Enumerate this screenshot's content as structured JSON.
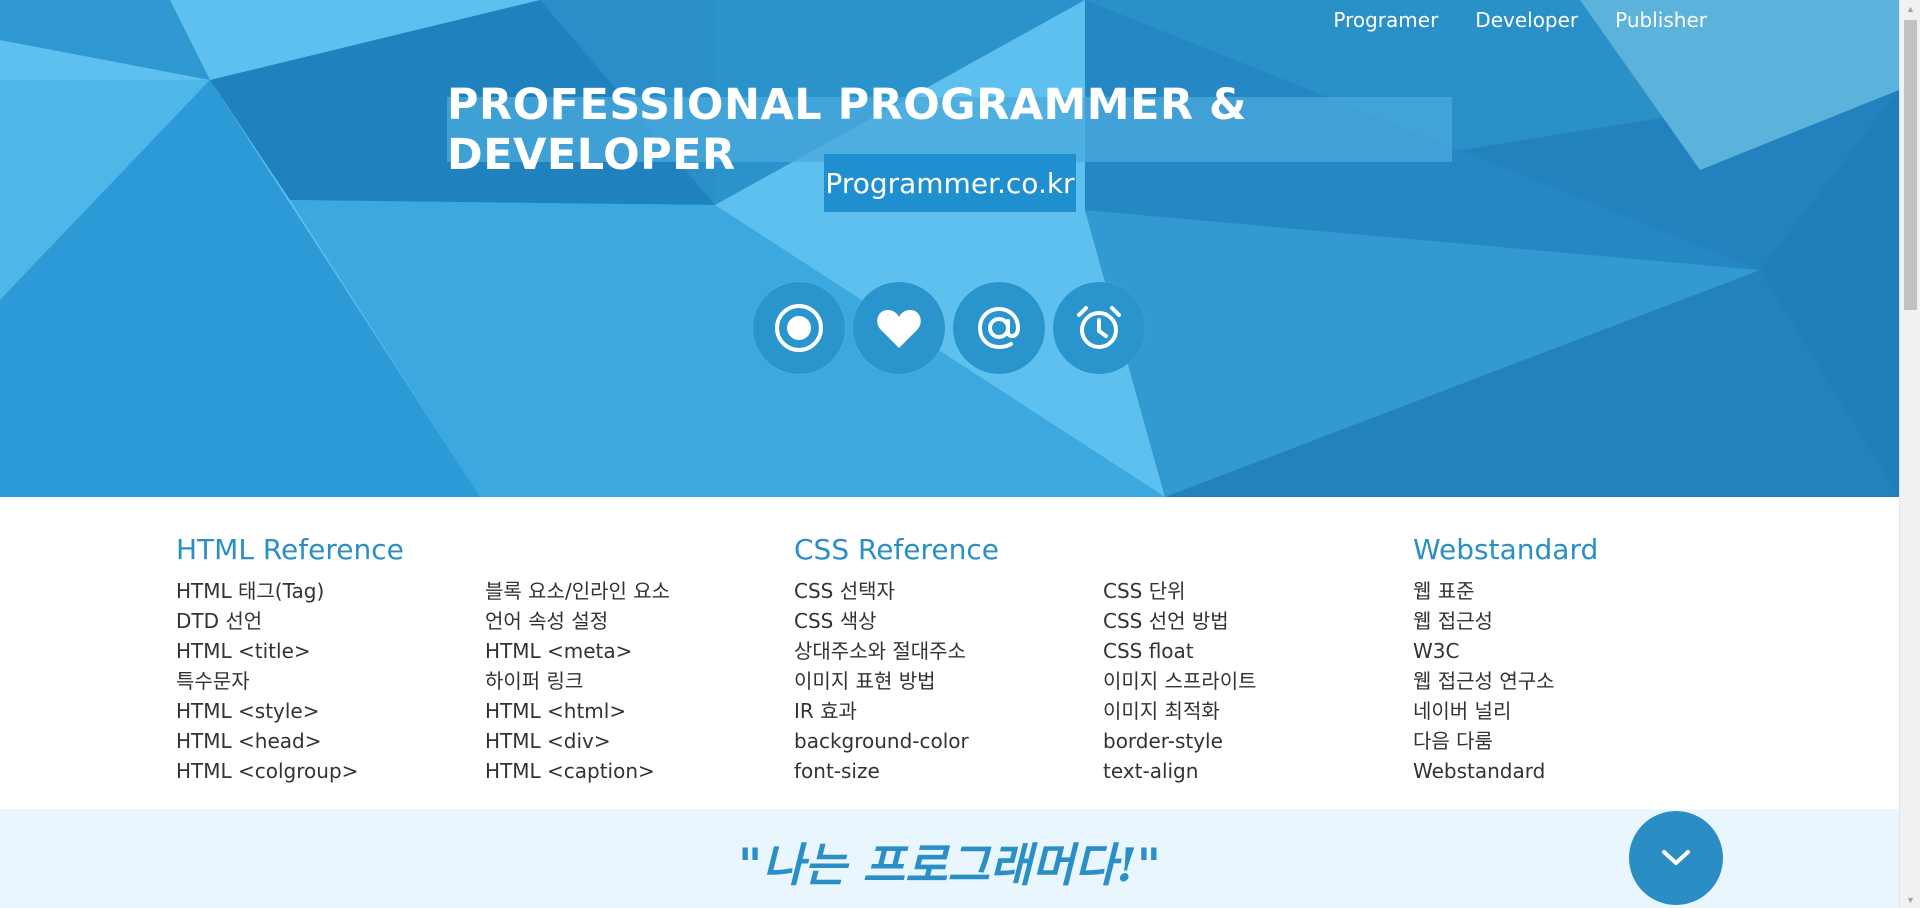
{
  "nav": {
    "items": [
      "Programer",
      "Developer",
      "Publisher"
    ]
  },
  "hero": {
    "title": "PROFESSIONAL PROGRAMMER & DEVELOPER",
    "subtitle": "Programmer.co.kr",
    "icons": [
      "target-icon",
      "heart-icon",
      "at-sign-icon",
      "alarm-clock-icon"
    ]
  },
  "sections": {
    "html": {
      "heading": "HTML Reference",
      "col1": [
        "HTML 태그(Tag)",
        "DTD 선언",
        "HTML <title>",
        "특수문자",
        "HTML <style>",
        "HTML <head>",
        "HTML <colgroup>"
      ],
      "col2": [
        "블록 요소/인라인 요소",
        "언어 속성 설정",
        "HTML <meta>",
        "하이퍼 링크",
        "HTML <html>",
        "HTML <div>",
        "HTML <caption>"
      ]
    },
    "css": {
      "heading": "CSS Reference",
      "col1": [
        "CSS 선택자",
        "CSS 색상",
        "상대주소와 절대주소",
        "이미지 표현 방법",
        "IR 효과",
        "background-color",
        "font-size"
      ],
      "col2": [
        "CSS 단위",
        "CSS 선언 방법",
        "CSS float",
        "이미지 스프라이트",
        "이미지 최적화",
        "border-style",
        "text-align"
      ]
    },
    "web": {
      "heading": "Webstandard",
      "col1": [
        "웹 표준",
        "웹 접근성",
        "W3C",
        "웹 접근성 연구소",
        "네이버 널리",
        "다음 다룸",
        "Webstandard"
      ]
    }
  },
  "band": {
    "slogan": "\"나는 프로그래머다!\""
  },
  "colors": {
    "accent": "#2a8fc7",
    "hero_base": "#2a9bd4",
    "band_bg": "#eaf6fd"
  }
}
